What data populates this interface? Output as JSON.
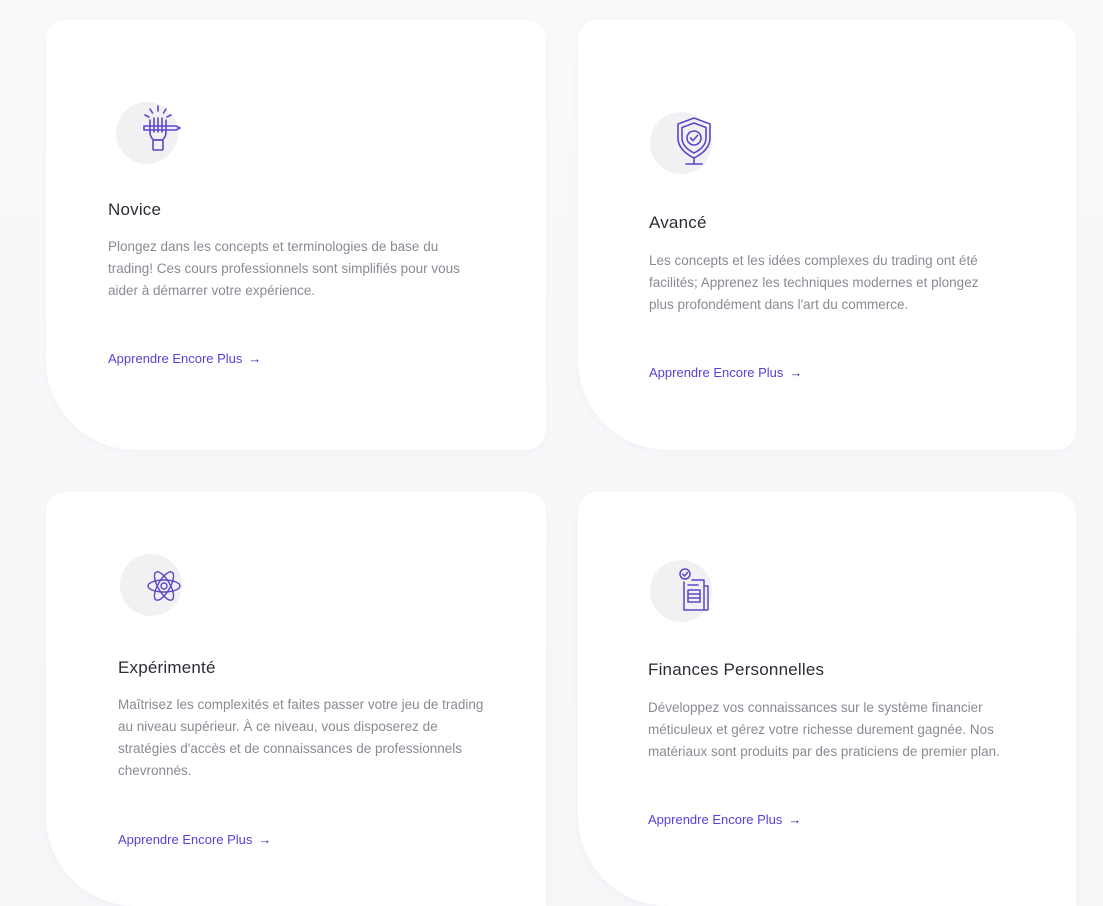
{
  "cards": [
    {
      "title": "Novice",
      "description": "Plongez dans les concepts et terminologies de base du trading! Ces cours professionnels sont simplifiés pour vous aider à démarrer votre expérience.",
      "link_label": "Apprendre Encore Plus",
      "icon": "hand-pencil-icon"
    },
    {
      "title": "Avancé",
      "description": "Les concepts et les idées complexes du trading ont été facilités; Apprenez les techniques modernes et plongez plus profondément dans l'art du commerce.",
      "link_label": "Apprendre Encore Plus",
      "icon": "shield-check-icon"
    },
    {
      "title": "Expérimenté",
      "description": "Maîtrisez les complexités et faites passer votre jeu de trading au niveau supérieur. À ce niveau, vous disposerez de stratégies d'accès et de connaissances de professionnels chevronnés.",
      "link_label": "Apprendre Encore Plus",
      "icon": "atom-icon"
    },
    {
      "title": "Finances Personnelles",
      "description": "Développez vos connaissances sur le système financier méticuleux et gérez votre richesse durement gagnée. Nos matériaux sont produits par des praticiens de premier plan.",
      "link_label": "Apprendre Encore Plus",
      "icon": "document-check-icon"
    }
  ],
  "colors": {
    "accent": "#5b3fd6",
    "icon_stroke": "#5a48c8",
    "blob": "#f1f1f4",
    "title": "#2c2c38",
    "text": "#8a8a96"
  },
  "arrow_glyph": "→"
}
